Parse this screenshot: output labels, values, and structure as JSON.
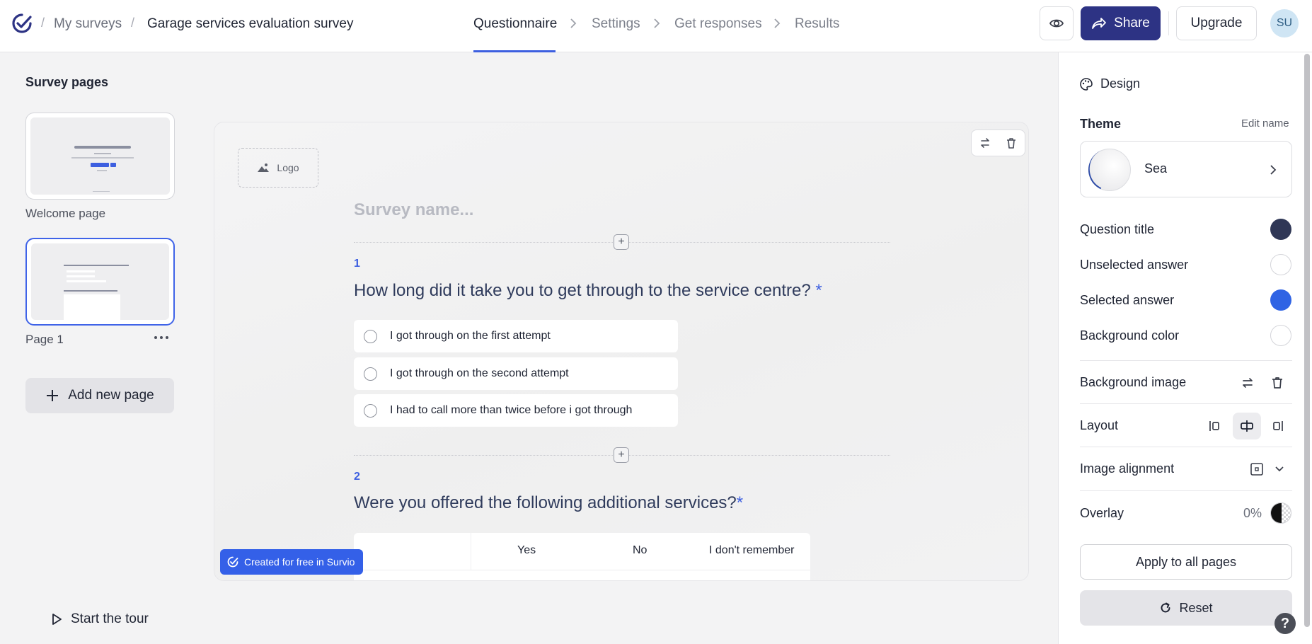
{
  "header": {
    "breadcrumbs": [
      "My surveys",
      "Garage services evaluation survey"
    ],
    "tabs": [
      {
        "label": "Questionnaire",
        "active": true
      },
      {
        "label": "Settings",
        "active": false
      },
      {
        "label": "Get responses",
        "active": false
      },
      {
        "label": "Results",
        "active": false
      }
    ],
    "share_label": "Share",
    "upgrade_label": "Upgrade",
    "avatar_initials": "SU",
    "brand_color": "#2d3384",
    "accent_color": "#3d5fe0"
  },
  "sidebar": {
    "title": "Survey pages",
    "pages": [
      {
        "label": "Welcome page",
        "selected": false
      },
      {
        "label": "Page 1",
        "selected": true
      }
    ],
    "add_page_label": "Add new page",
    "tour_label": "Start the tour"
  },
  "canvas": {
    "logo_label": "Logo",
    "survey_name_placeholder": "Survey name...",
    "questions": [
      {
        "number": "1",
        "title": "How long did it take you to get through to the service centre?",
        "required_mark": "*",
        "options": [
          "I got through on the first attempt",
          "I got through on the second attempt",
          "I had to call more than twice before i got through"
        ]
      },
      {
        "number": "2",
        "title": "Were you offered the following additional services?",
        "required_mark": "*",
        "columns": [
          "Yes",
          "No",
          "I don't remember"
        ]
      }
    ],
    "badge_label": "Created for free in Survio"
  },
  "design_panel": {
    "title": "Design",
    "theme_label": "Theme",
    "edit_name_label": "Edit name",
    "theme_name": "Sea",
    "colors": [
      {
        "label": "Question title",
        "value": "#2f3756"
      },
      {
        "label": "Unselected answer",
        "value": "#ffffff"
      },
      {
        "label": "Selected answer",
        "value": "#2f63e4"
      },
      {
        "label": "Background color",
        "value": "#ffffff"
      }
    ],
    "background_image_label": "Background image",
    "layout_label": "Layout",
    "layout_selected": "center",
    "image_alignment_label": "Image alignment",
    "overlay_label": "Overlay",
    "overlay_value": "0%",
    "apply_label": "Apply to all pages",
    "reset_label": "Reset",
    "help_label": "?"
  }
}
